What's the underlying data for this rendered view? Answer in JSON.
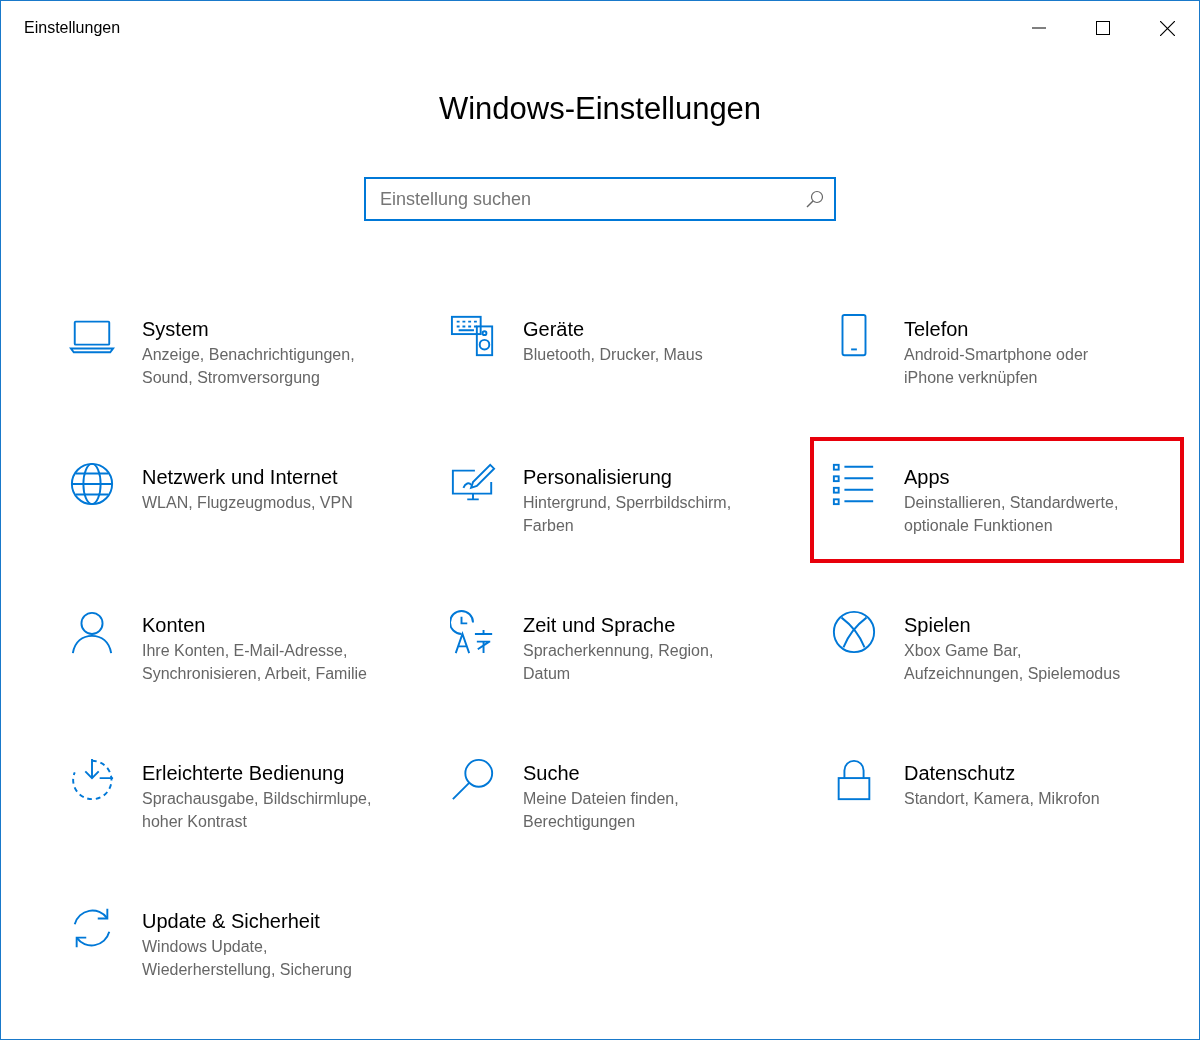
{
  "window": {
    "title": "Einstellungen"
  },
  "heading": "Windows-Einstellungen",
  "search": {
    "placeholder": "Einstellung suchen"
  },
  "tiles": [
    {
      "title": "System",
      "description": "Anzeige, Benachrichtigungen, Sound, Stromversorgung",
      "highlighted": false
    },
    {
      "title": "Geräte",
      "description": "Bluetooth, Drucker, Maus",
      "highlighted": false
    },
    {
      "title": "Telefon",
      "description": "Android-Smartphone oder iPhone verknüpfen",
      "highlighted": false
    },
    {
      "title": "Netzwerk und Internet",
      "description": "WLAN, Flugzeugmodus, VPN",
      "highlighted": false
    },
    {
      "title": "Personalisierung",
      "description": "Hintergrund, Sperrbildschirm, Farben",
      "highlighted": false
    },
    {
      "title": "Apps",
      "description": "Deinstallieren, Standardwerte, optionale Funktionen",
      "highlighted": true
    },
    {
      "title": "Konten",
      "description": "Ihre Konten, E-Mail-Adresse, Synchronisieren, Arbeit, Familie",
      "highlighted": false
    },
    {
      "title": "Zeit und Sprache",
      "description": "Spracherkennung, Region, Datum",
      "highlighted": false
    },
    {
      "title": "Spielen",
      "description": "Xbox Game Bar, Aufzeichnungen, Spielemodus",
      "highlighted": false
    },
    {
      "title": "Erleichterte Bedienung",
      "description": "Sprachausgabe, Bildschirmlupe, hoher Kontrast",
      "highlighted": false
    },
    {
      "title": "Suche",
      "description": "Meine Dateien finden, Berechtigungen",
      "highlighted": false
    },
    {
      "title": "Datenschutz",
      "description": "Standort, Kamera, Mikrofon",
      "highlighted": false
    },
    {
      "title": "Update & Sicherheit",
      "description": "Windows Update, Wiederherstellung, Sicherung",
      "highlighted": false
    }
  ]
}
